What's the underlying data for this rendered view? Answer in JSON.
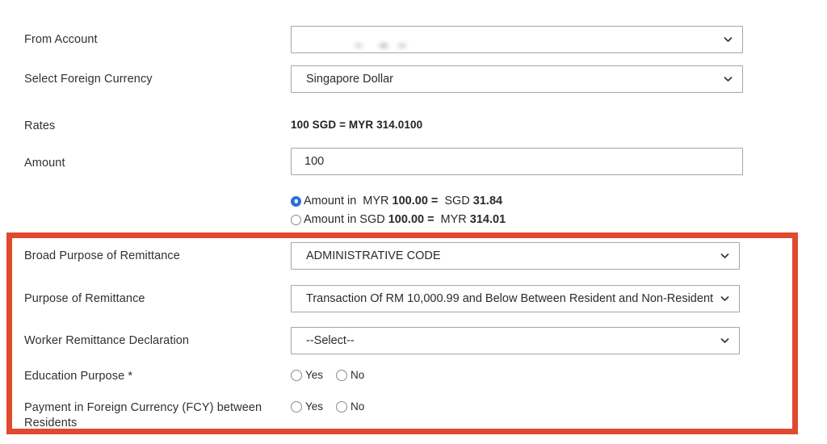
{
  "form": {
    "rows": [
      {
        "id": "from-account",
        "label": "From Account",
        "type": "select",
        "value": "",
        "redacted": true
      },
      {
        "id": "select-foreign-currency",
        "label": "Select Foreign Currency",
        "type": "select",
        "value": "Singapore Dollar",
        "redacted": false
      },
      {
        "id": "rates",
        "label": "Rates",
        "type": "static",
        "value": "100 SGD = MYR 314.0100"
      },
      {
        "id": "amount",
        "label": "Amount",
        "type": "text",
        "value": "100"
      }
    ],
    "amount_options": [
      {
        "selected": true,
        "prefix": "Amount in",
        "from_currency": "MYR",
        "from_value": "100.00",
        "equals": "=",
        "to_currency": "SGD",
        "to_value": "31.84"
      },
      {
        "selected": false,
        "prefix": "Amount in",
        "from_currency": "SGD",
        "from_value": "100.00",
        "equals": "=",
        "to_currency": "MYR",
        "to_value": "314.01"
      }
    ],
    "highlighted_section": {
      "border_color": "#e04a2f",
      "rows": [
        {
          "id": "broad-purpose-of-remittance",
          "label": "Broad Purpose of Remittance",
          "type": "select",
          "value": "ADMINISTRATIVE CODE"
        },
        {
          "id": "purpose-of-remittance",
          "label": "Purpose of Remittance",
          "type": "select",
          "value": "Transaction Of RM 10,000.99 and Below Between Resident and Non-Resident"
        },
        {
          "id": "worker-remittance-declaration",
          "label": "Worker Remittance Declaration",
          "type": "select",
          "value": "--Select--"
        },
        {
          "id": "education-purpose",
          "label": "Education Purpose *",
          "type": "radio",
          "options": [
            "Yes",
            "No"
          ],
          "selected": null
        },
        {
          "id": "payment-in-foreign-currency-between-residents",
          "label": "Payment in Foreign Currency (FCY) between Residents",
          "type": "radio",
          "options": [
            "Yes",
            "No"
          ],
          "selected": null
        }
      ]
    }
  },
  "icons": {
    "chevron_down": "chevron-down-icon"
  }
}
